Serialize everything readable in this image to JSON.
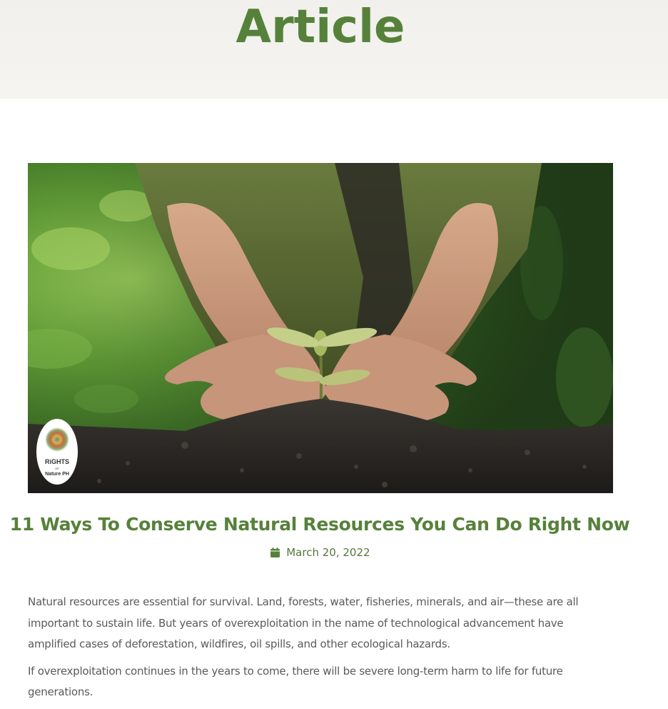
{
  "theme": {
    "accent": "#56813a",
    "banner_bg": "#f3f2ee",
    "body_text": "#5a5a5a"
  },
  "header": {
    "title": "Article"
  },
  "featured_image": {
    "alt": "Hands cupping a young seedling growing in dark soil",
    "logo_text": "RiGHTS OF Nature PH"
  },
  "post": {
    "title": "11 Ways To Conserve Natural Resources You Can Do Right Now",
    "date": "March 20, 2022",
    "date_icon": "calendar-icon",
    "paragraphs": [
      "Natural resources are essential for survival. Land, forests, water, fisheries, minerals, and air—these are all important to sustain life. But years of overexploitation in the name of technological advancement have amplified cases of deforestation, wildfires, oil spills, and other ecological hazards.",
      "If overexploitation continues in the years to come, there will be severe long-term harm to life for future generations."
    ]
  }
}
